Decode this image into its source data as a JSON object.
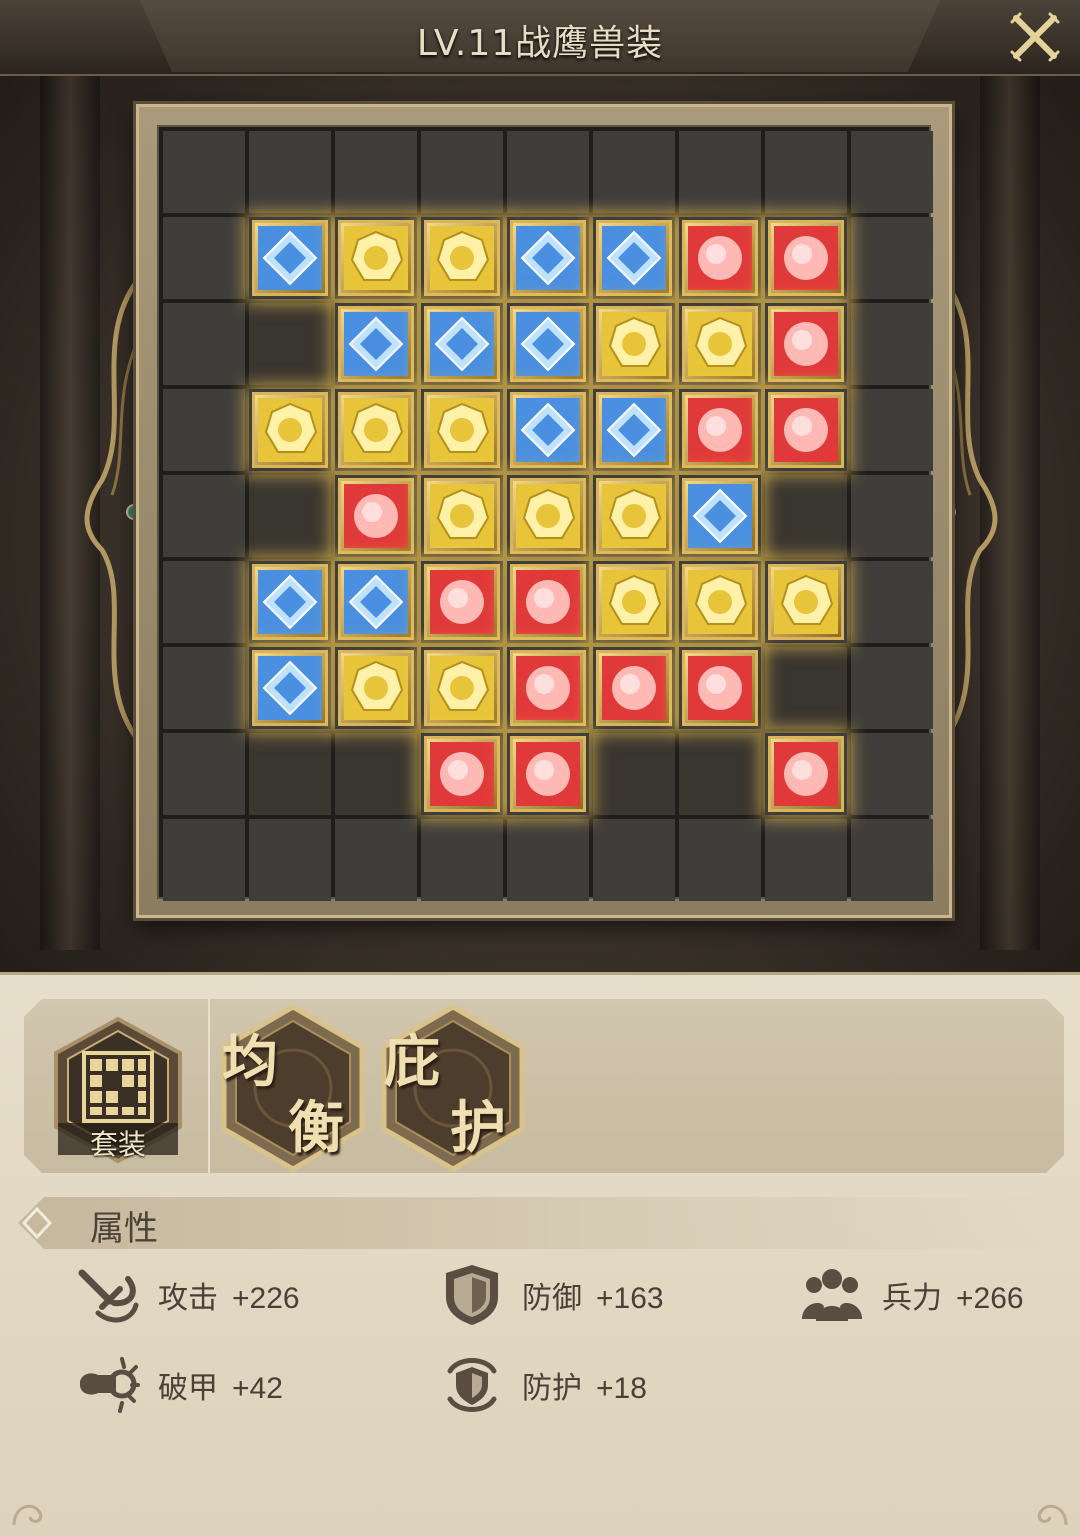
{
  "window": {
    "title": "LV.11战鹰兽装"
  },
  "board": {
    "cols": 9,
    "rows": 9,
    "cells": [
      [
        0,
        0,
        0,
        0,
        0,
        0,
        0,
        0,
        0
      ],
      [
        0,
        "b",
        "y",
        "y",
        "b",
        "b",
        "r",
        "r",
        0
      ],
      [
        0,
        "_",
        "b",
        "b",
        "b",
        "y",
        "y",
        "r",
        0
      ],
      [
        0,
        "y",
        "y",
        "y",
        "b",
        "b",
        "r",
        "r",
        0
      ],
      [
        0,
        "_",
        "r",
        "y",
        "y",
        "y",
        "b",
        "_",
        0
      ],
      [
        0,
        "b",
        "b",
        "r",
        "r",
        "y",
        "y",
        "y",
        0
      ],
      [
        0,
        "b",
        "y",
        "y",
        "r",
        "r",
        "r",
        "_",
        0
      ],
      [
        0,
        "_",
        "_",
        "r",
        "r",
        "_",
        "_",
        "r",
        0
      ],
      [
        0,
        0,
        0,
        0,
        0,
        0,
        0,
        0,
        0
      ]
    ],
    "gem_colors": {
      "b": "#4a8fe0",
      "y": "#e8c43a",
      "r": "#e0393a"
    }
  },
  "sets": {
    "suit_label": "套装",
    "badges": [
      {
        "id": "balance",
        "chars": [
          "均",
          "衡"
        ]
      },
      {
        "id": "shelter",
        "chars": [
          "庇",
          "护"
        ]
      }
    ]
  },
  "attributes": {
    "title": "属性",
    "items": [
      {
        "id": "attack",
        "name": "攻击",
        "value": "+226",
        "icon": "sword-icon"
      },
      {
        "id": "defense",
        "name": "防御",
        "value": "+163",
        "icon": "shield-icon"
      },
      {
        "id": "troops",
        "name": "兵力",
        "value": "+266",
        "icon": "troops-icon"
      },
      {
        "id": "pierce",
        "name": "破甲",
        "value": "+42",
        "icon": "armor-break-icon"
      },
      {
        "id": "protect",
        "name": "防护",
        "value": "+18",
        "icon": "protection-icon"
      }
    ]
  },
  "colors": {
    "accent_gold": "#d9b45a",
    "panel_bg": "#e3d9c5",
    "text_dark": "#4a4035"
  }
}
